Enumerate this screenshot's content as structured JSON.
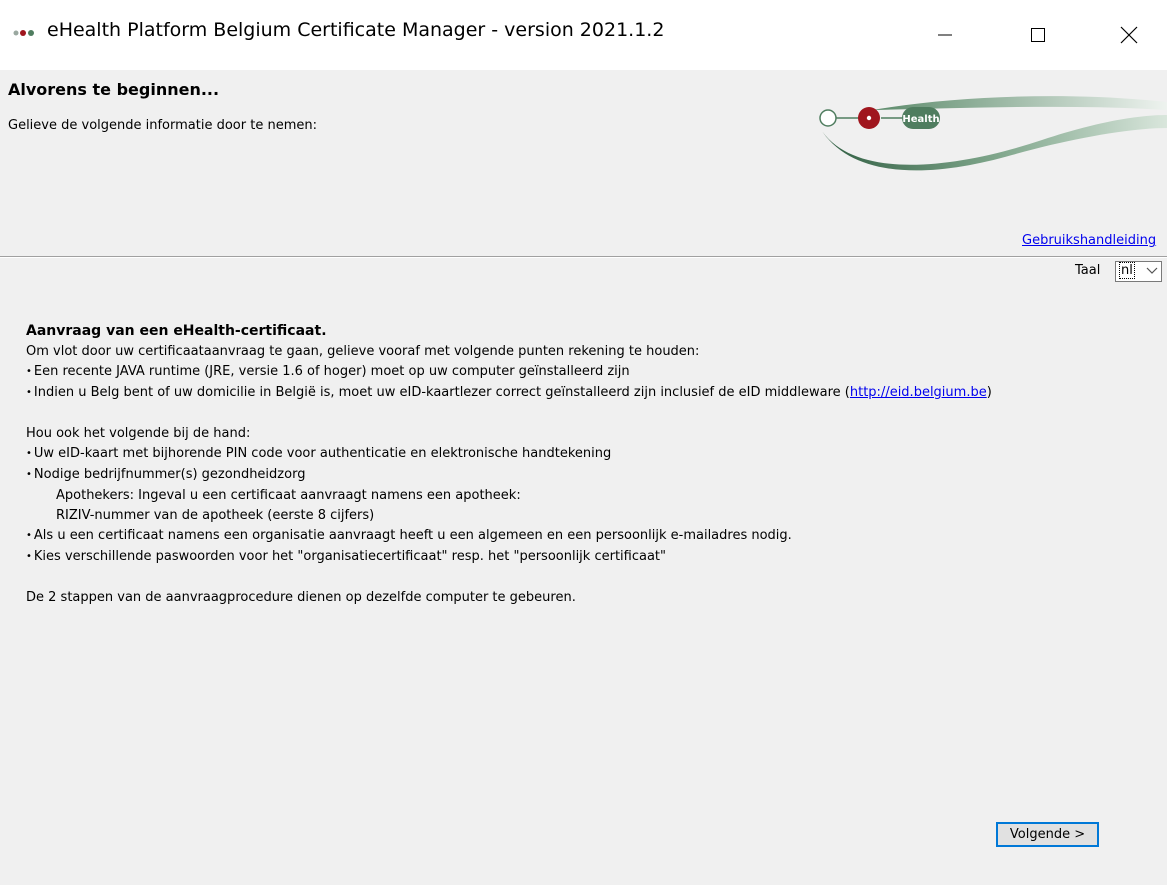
{
  "window": {
    "title": "eHealth Platform Belgium Certificate Manager - version 2021.1.2",
    "controls": [
      "minimize",
      "maximize",
      "close"
    ]
  },
  "header": {
    "title": "Alvorens te beginnen...",
    "subtitle": "Gelieve de volgende informatie door te nemen:",
    "logo_text": "Health",
    "manual_link": "Gebruikshandleiding"
  },
  "language": {
    "label": "Taal",
    "selected": "nl"
  },
  "content": {
    "heading": "Aanvraag van een eHealth-certificaat.",
    "intro": "Om vlot door uw certificaataanvraag te gaan, gelieve vooraf met volgende punten rekening te houden:",
    "req1": "Een recente JAVA runtime (JRE, versie 1.6 of hoger) moet op uw computer geïnstalleerd zijn",
    "req2_prefix": "Indien u Belg bent of uw domicilie in België is, moet uw eID-kaartlezer correct geïnstalleerd zijn inclusief de eID middleware (",
    "req2_link": "http://eid.belgium.be",
    "req2_suffix": ")",
    "keep_title": "Hou ook het volgende bij de hand:",
    "item1": "Uw eID-kaart met bijhorende PIN code voor authenticatie en elektronische handtekening",
    "item2": "Nodige bedrijfnummer(s) gezondheidzorg",
    "item2_sub1": "Apothekers: Ingeval u een certificaat aanvraagt namens een apotheek:",
    "item2_sub2": "RIZIV-nummer van de apotheek (eerste 8 cijfers)",
    "item3": "Als u een certificaat namens een organisatie aanvraagt heeft u een algemeen en een persoonlijk e-mailadres nodig.",
    "item4": "Kies verschillende paswoorden voor het \"organisatiecertificaat\" resp. het \"persoonlijk certificaat\"",
    "closing": "De 2 stappen van de aanvraagprocedure dienen op dezelfde computer te gebeuren."
  },
  "footer": {
    "next_label": "Volgende >"
  },
  "colors": {
    "logo_green": "#4f7d5f",
    "logo_red": "#a0161e",
    "link_blue": "#0000ee",
    "focus_blue": "#0078d7"
  }
}
